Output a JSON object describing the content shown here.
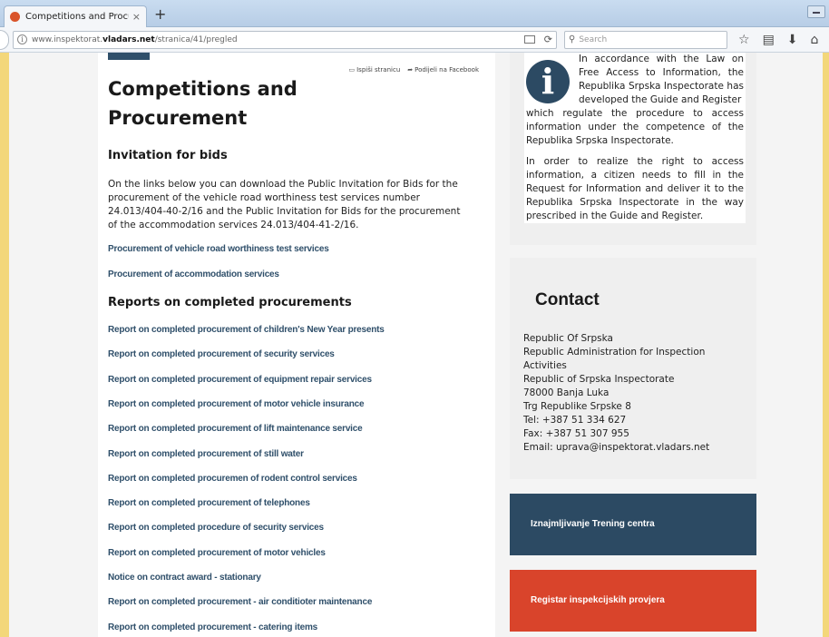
{
  "browser": {
    "tab_title": "Competitions and Procure...",
    "tab_close": "×",
    "new_tab": "+",
    "url_prefix": "www.inspektorat.",
    "url_host": "vladars.net",
    "url_path": "/stranica/41/pregled",
    "search_placeholder": "Search"
  },
  "page": {
    "share_print": "Ispiši stranicu",
    "share_facebook": "Podijeli na Facebook",
    "title": "Competitions and Procurement",
    "invitation_heading": "Invitation for bids",
    "invitation_text": "On the links below you can download the Public Invitation for Bids for the procurement of the vehicle road worthiness test services number 24.013/404-40-2/16 and the Public Invitation for Bids for the procurement of the accommodation services 24.013/404-41-2/16.",
    "invitation_links": [
      "Procurement of vehicle road worthiness test services",
      "Procurement of accommodation services"
    ],
    "reports_heading": "Reports on completed procurements",
    "report_links": [
      "Report on completed procurement of children's New Year presents",
      "Report on completed procurement of security services",
      "Report on completed procurement of equipment repair services",
      "Report on completed procurement of motor vehicle insurance",
      "Report on completed procurement of lift maintenance service",
      "Report on completed procurement of still water",
      "Report on completed procuremen of rodent control services",
      "Report on completed procurement of telephones",
      "Report on completed procedure of security services",
      "Report on completed procurement of motor vehicles",
      "Notice on contract award - stationary",
      "Report on completed procurement - air conditioter maintenance",
      "Report on completed procurement - catering items"
    ]
  },
  "sidebar": {
    "info_p1a": "In accordance with the Law on Free Access to Information, the Republika Srpska Inspectorate has developed the Guide and Register",
    "info_p1b": "which regulate the procedure to access information under the competence of the Republika Srpska Inspectorate.",
    "info_p2": "In order to realize the right to access information, a citizen needs to fill in the Request for Information and deliver it to the Republika Srpska Inspectorate in the way prescribed in the Guide and Register.",
    "contact_title": "Contact",
    "contact_lines": [
      "Republic Of Srpska",
      "Republic Administration for Inspection Activities",
      "Republic of Srpska Inspectorate",
      "78000 Banja Luka",
      "Trg Republike Srpske 8",
      "Tel: +387 51 334 627",
      "Fax: +387 51 307 955",
      "Email: uprava@inspektorat.vladars.net"
    ],
    "training_button": "Iznajmljivanje Trening centra",
    "register_button": "Registar inspekcijskih provjera"
  },
  "colors": {
    "accent_dark": "#2c4a63",
    "accent_red": "#d9442b",
    "link": "#2f4f6a"
  }
}
